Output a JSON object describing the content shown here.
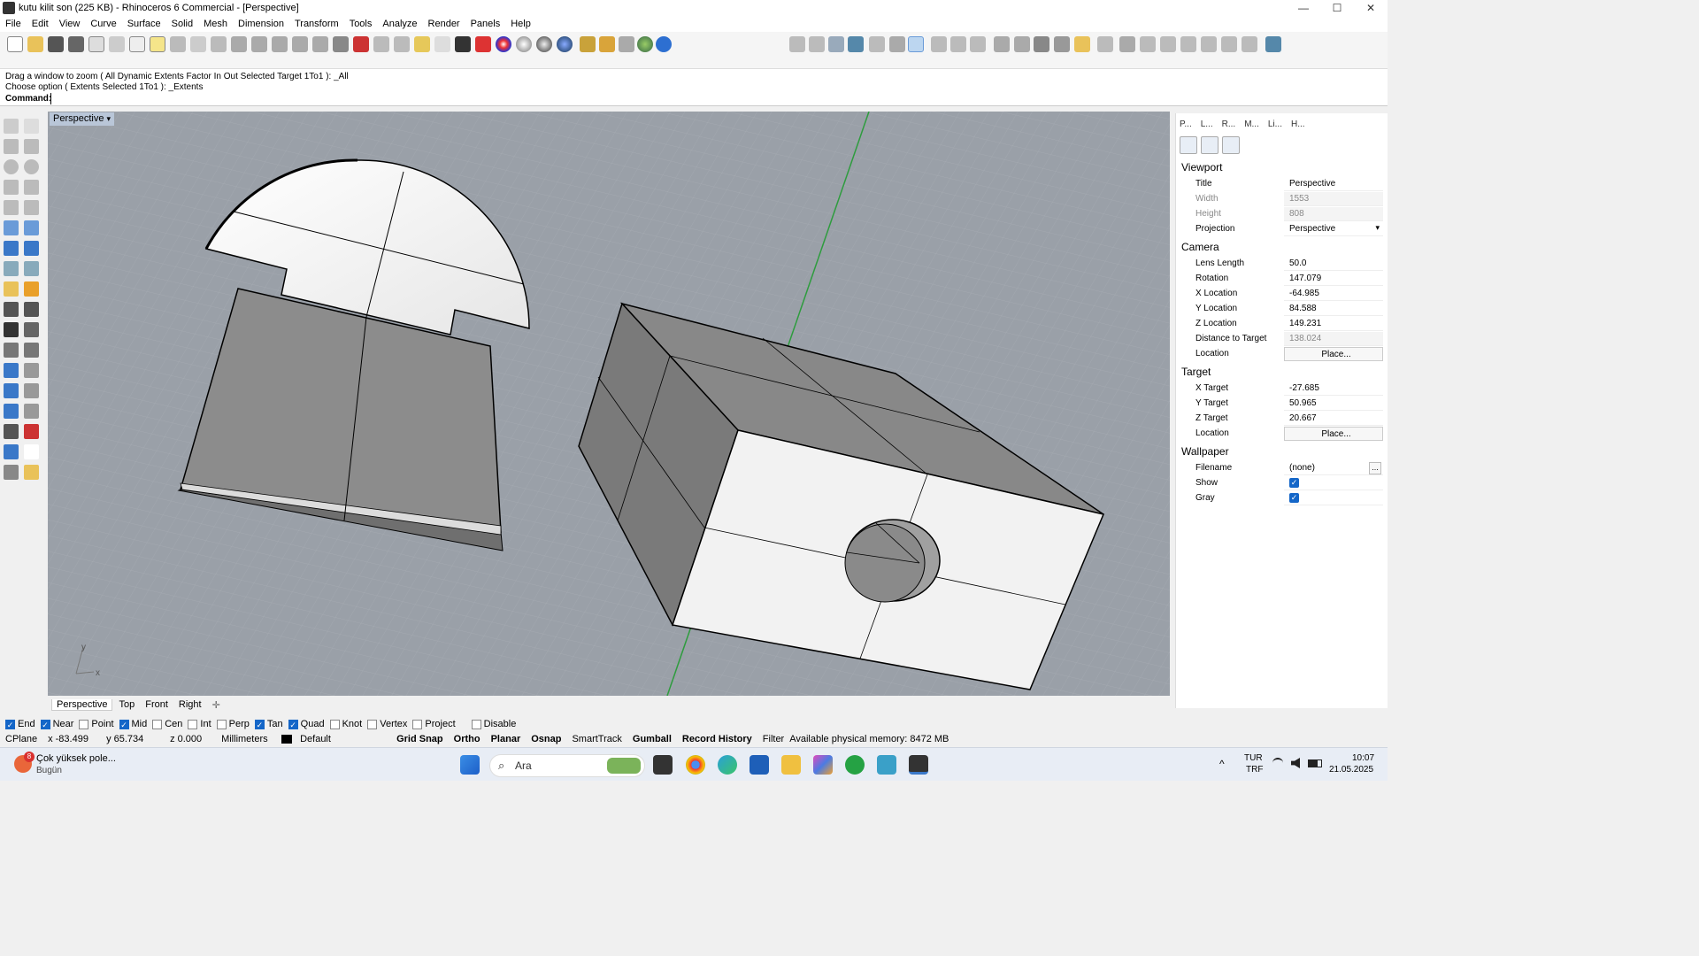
{
  "window": {
    "title": "kutu kilit son (225 KB) - Rhinoceros 6 Commercial - [Perspective]",
    "min": "—",
    "max": "☐",
    "close": "✕"
  },
  "menu": [
    "File",
    "Edit",
    "View",
    "Curve",
    "Surface",
    "Solid",
    "Mesh",
    "Dimension",
    "Transform",
    "Tools",
    "Analyze",
    "Render",
    "Panels",
    "Help"
  ],
  "command": {
    "line1": "Drag a window to zoom ( All  Dynamic  Extents  Factor  In  Out  Selected  Target  1To1 ): _All",
    "line2": "Choose option ( Extents  Selected  1To1 ): _Extents",
    "prompt": "Command:"
  },
  "viewport": {
    "label": "Perspective",
    "tabs": [
      "Perspective",
      "Top",
      "Front",
      "Right"
    ],
    "add_tab": "✛",
    "axis_y": "y",
    "axis_x": "x"
  },
  "panel": {
    "tabs": [
      "P...",
      "L...",
      "R...",
      "M...",
      "Li...",
      "H..."
    ],
    "viewport_section": "Viewport",
    "viewport_rows": [
      {
        "k": "Title",
        "v": "Perspective"
      },
      {
        "k": "Width",
        "v": "1553"
      },
      {
        "k": "Height",
        "v": "808"
      },
      {
        "k": "Projection",
        "v": "Perspective"
      }
    ],
    "camera_section": "Camera",
    "camera_rows": [
      {
        "k": "Lens Length",
        "v": "50.0"
      },
      {
        "k": "Rotation",
        "v": "147.079"
      },
      {
        "k": "X Location",
        "v": "-64.985"
      },
      {
        "k": "Y Location",
        "v": "84.588"
      },
      {
        "k": "Z Location",
        "v": "149.231"
      },
      {
        "k": "Distance to Target",
        "v": "138.024"
      },
      {
        "k": "Location",
        "v": "Place..."
      }
    ],
    "target_section": "Target",
    "target_rows": [
      {
        "k": "X Target",
        "v": "-27.685"
      },
      {
        "k": "Y Target",
        "v": "50.965"
      },
      {
        "k": "Z Target",
        "v": "20.667"
      },
      {
        "k": "Location",
        "v": "Place..."
      }
    ],
    "wallpaper_section": "Wallpaper",
    "wallpaper_rows": [
      {
        "k": "Filename",
        "v": "(none)"
      },
      {
        "k": "Show",
        "v": "✓"
      },
      {
        "k": "Gray",
        "v": "✓"
      }
    ],
    "browse": "..."
  },
  "osnap": [
    {
      "label": "End",
      "on": true
    },
    {
      "label": "Near",
      "on": true
    },
    {
      "label": "Point",
      "on": false
    },
    {
      "label": "Mid",
      "on": true
    },
    {
      "label": "Cen",
      "on": false
    },
    {
      "label": "Int",
      "on": false
    },
    {
      "label": "Perp",
      "on": false
    },
    {
      "label": "Tan",
      "on": true
    },
    {
      "label": "Quad",
      "on": true
    },
    {
      "label": "Knot",
      "on": false
    },
    {
      "label": "Vertex",
      "on": false
    },
    {
      "label": "Project",
      "on": false
    },
    {
      "label": "Disable",
      "on": false
    }
  ],
  "status": {
    "cplane": "CPlane",
    "x": "x -83.499",
    "y": "y 65.734",
    "z": "z 0.000",
    "units": "Millimeters",
    "layer": "Default",
    "grid_snap": "Grid Snap",
    "ortho": "Ortho",
    "planar": "Planar",
    "osnap": "Osnap",
    "smarttrack": "SmartTrack",
    "gumball": "Gumball",
    "record_history": "Record History",
    "filter": "Filter",
    "memory": "Available physical memory: 8472 MB"
  },
  "taskbar": {
    "weather_badge": "8",
    "weather_title": "Çok yüksek pole...",
    "weather_sub": "Bugün",
    "search_placeholder": "Ara",
    "lang1": "TUR",
    "lang2": "TRF",
    "time": "10:07",
    "date": "21.05.2025",
    "up_arrow": "^"
  }
}
